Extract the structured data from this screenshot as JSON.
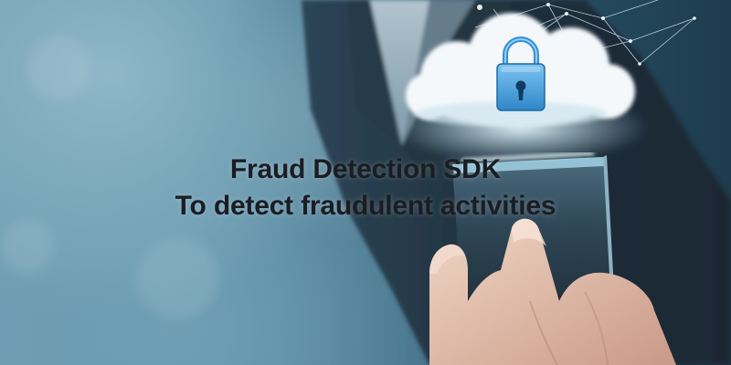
{
  "banner": {
    "title_line_1": "Fraud Detection SDK",
    "title_line_2": "To detect fraudulent activities"
  },
  "visual": {
    "icons": [
      "cloud-icon",
      "padlock-icon",
      "smartphone",
      "hand"
    ],
    "colors": {
      "background_light": "#8fb7c8",
      "background_dark": "#1d3c4e",
      "suit": "#1f2c38",
      "lock_blue": "#4a9fd8",
      "text": "#1a1d22"
    }
  }
}
